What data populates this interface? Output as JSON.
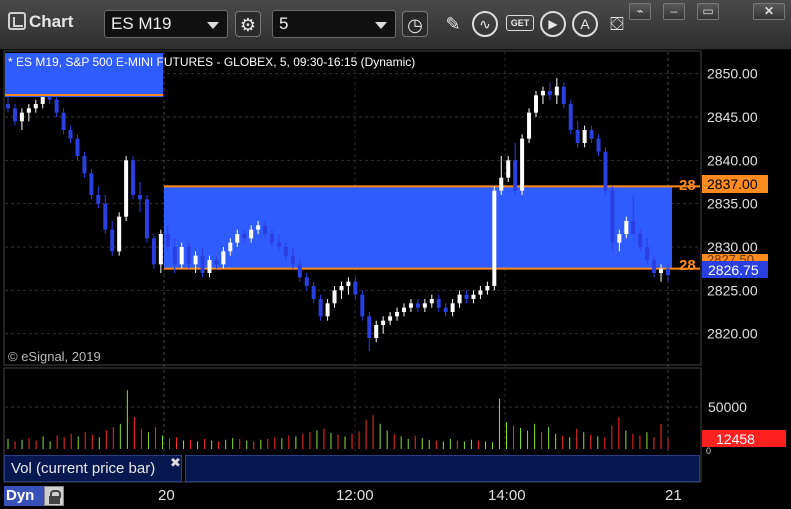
{
  "app": {
    "title": "Chart"
  },
  "toolbar": {
    "symbol": "ES M19",
    "interval": "5",
    "icons": [
      "settings-icon",
      "clock-icon",
      "pencil-icon",
      "line-chart-icon",
      "get-icon",
      "play-icon",
      "alert-icon",
      "fill-icon"
    ],
    "get_label": "GET"
  },
  "window_buttons": [
    "link-icon",
    "minimize-icon",
    "restore-icon",
    "close-icon"
  ],
  "chart": {
    "header": "* ES M19, S&P 500 E-MINI FUTURES - GLOBEX, 5, 09:30-16:15 (Dynamic)",
    "watermark": "© eSignal, 2019",
    "price_ticks": [
      "2850.00",
      "2845.00",
      "2840.00",
      "2835.00",
      "2830.00",
      "2825.00",
      "2820.00"
    ],
    "last_price": "2826.75",
    "level_upper": "2837.00",
    "level_upper_left": "28",
    "level_lower_left": "28",
    "level_lower_partial": "2827.50",
    "volume_tick": "50000",
    "volume_value": "12458",
    "volume_zero": "0",
    "time_labels": [
      "20",
      "12:00",
      "14:00",
      "21"
    ],
    "colors": {
      "up": "#ffffff",
      "down": "#2a3fe0",
      "zone": "#2f5cff",
      "level": "#ff8a1e",
      "vol_up": "#8ae234",
      "vol_down": "#ff2a2a"
    }
  },
  "chart_data": {
    "type": "candlestick",
    "symbol": "ES M19",
    "ylim": [
      2816.5,
      2852.5
    ],
    "levels": [
      2837.0,
      2827.5
    ],
    "last": 2826.75,
    "candles": [
      [
        2846.5,
        2847.5,
        2845.5,
        2846
      ],
      [
        2846,
        2846.5,
        2844,
        2844.5
      ],
      [
        2844.5,
        2846,
        2843.5,
        2845.5
      ],
      [
        2845.5,
        2846.5,
        2844.5,
        2846
      ],
      [
        2846,
        2847,
        2845.5,
        2846.5
      ],
      [
        2846.5,
        2848,
        2846,
        2847.5
      ],
      [
        2847.5,
        2848.5,
        2846.5,
        2847
      ],
      [
        2847,
        2848,
        2845,
        2845.5
      ],
      [
        2845.5,
        2846,
        2843,
        2843.5
      ],
      [
        2843.5,
        2844,
        2842,
        2842.5
      ],
      [
        2842.5,
        2843,
        2840,
        2840.5
      ],
      [
        2840.5,
        2841,
        2838,
        2838.5
      ],
      [
        2838.5,
        2839,
        2835.5,
        2836
      ],
      [
        2836,
        2837,
        2834.5,
        2835
      ],
      [
        2835,
        2836,
        2831.5,
        2832
      ],
      [
        2832,
        2833,
        2829,
        2829.5
      ],
      [
        2829.5,
        2834,
        2829,
        2833.5
      ],
      [
        2833.5,
        2840.5,
        2833,
        2840
      ],
      [
        2840,
        2840.5,
        2835.5,
        2836
      ],
      [
        2836,
        2837.5,
        2834,
        2835.5
      ],
      [
        2835.5,
        2836,
        2830.5,
        2831
      ],
      [
        2831,
        2831.5,
        2827.5,
        2828
      ],
      [
        2828,
        2832,
        2827,
        2831.5
      ],
      [
        2831.5,
        2832.5,
        2829.5,
        2830
      ],
      [
        2830,
        2831,
        2827,
        2828
      ],
      [
        2828,
        2830.5,
        2827.5,
        2830
      ],
      [
        2830,
        2830.5,
        2827.5,
        2828
      ],
      [
        2828,
        2829.5,
        2827,
        2829
      ],
      [
        2829,
        2830,
        2826.5,
        2827
      ],
      [
        2827,
        2829,
        2826.5,
        2828.5
      ],
      [
        2828.5,
        2829,
        2827.5,
        2828
      ],
      [
        2828,
        2830,
        2827.5,
        2829.5
      ],
      [
        2829.5,
        2831,
        2829,
        2830.5
      ],
      [
        2830.5,
        2832,
        2830,
        2831.5
      ],
      [
        2831.5,
        2832,
        2830.5,
        2831
      ],
      [
        2831,
        2832.5,
        2830.5,
        2832
      ],
      [
        2832,
        2833,
        2831.5,
        2832.5
      ],
      [
        2832.5,
        2833,
        2831,
        2831.5
      ],
      [
        2831.5,
        2832,
        2830,
        2830.5
      ],
      [
        2830.5,
        2831.5,
        2829.5,
        2830
      ],
      [
        2830,
        2830.5,
        2828.5,
        2829
      ],
      [
        2829,
        2830,
        2827.5,
        2828
      ],
      [
        2828,
        2828.5,
        2826,
        2826.5
      ],
      [
        2826.5,
        2827,
        2825,
        2825.5
      ],
      [
        2825.5,
        2826,
        2823.5,
        2824
      ],
      [
        2824,
        2824.5,
        2821.5,
        2822
      ],
      [
        2822,
        2824,
        2821.5,
        2823.5
      ],
      [
        2823.5,
        2825.5,
        2823,
        2825
      ],
      [
        2825,
        2826,
        2824,
        2825.5
      ],
      [
        2825.5,
        2826.5,
        2824.5,
        2826
      ],
      [
        2826,
        2826.5,
        2824,
        2824.5
      ],
      [
        2824.5,
        2825,
        2821.5,
        2822
      ],
      [
        2822,
        2822.5,
        2818,
        2819.5
      ],
      [
        2819.5,
        2821.5,
        2819,
        2821
      ],
      [
        2821,
        2822,
        2820,
        2821.5
      ],
      [
        2821.5,
        2822.5,
        2821,
        2822
      ],
      [
        2822,
        2823,
        2821.5,
        2822.5
      ],
      [
        2822.5,
        2823.5,
        2822,
        2823
      ],
      [
        2823,
        2824,
        2822.5,
        2823.5
      ],
      [
        2823.5,
        2824,
        2822.5,
        2823
      ],
      [
        2823,
        2824,
        2822.5,
        2823.5
      ],
      [
        2823.5,
        2824.5,
        2823,
        2824
      ],
      [
        2824,
        2824.5,
        2822.5,
        2823
      ],
      [
        2823,
        2823.5,
        2822,
        2822.5
      ],
      [
        2822.5,
        2824,
        2822,
        2823.5
      ],
      [
        2823.5,
        2825,
        2823,
        2824.5
      ],
      [
        2824.5,
        2825,
        2823.5,
        2824
      ],
      [
        2824,
        2825,
        2823.5,
        2824.5
      ],
      [
        2824.5,
        2825.5,
        2824,
        2825
      ],
      [
        2825,
        2826,
        2824.5,
        2825.5
      ],
      [
        2825.5,
        2837,
        2825,
        2836.5
      ],
      [
        2836.5,
        2840.5,
        2836,
        2838
      ],
      [
        2838,
        2840.5,
        2837.5,
        2840
      ],
      [
        2840,
        2842,
        2836,
        2836.5
      ],
      [
        2836.5,
        2843,
        2836,
        2842.5
      ],
      [
        2842.5,
        2846,
        2842,
        2845.5
      ],
      [
        2845.5,
        2848,
        2845,
        2847.5
      ],
      [
        2847.5,
        2848.5,
        2846.5,
        2848
      ],
      [
        2848,
        2849,
        2847,
        2847.5
      ],
      [
        2847.5,
        2849.5,
        2846.5,
        2848.5
      ],
      [
        2848.5,
        2849,
        2846,
        2846.5
      ],
      [
        2846.5,
        2847,
        2843,
        2843.5
      ],
      [
        2843.5,
        2844.5,
        2841.5,
        2842
      ],
      [
        2842,
        2844,
        2841.5,
        2843.5
      ],
      [
        2843.5,
        2844,
        2842,
        2842.5
      ],
      [
        2842.5,
        2843,
        2840.5,
        2841
      ],
      [
        2841,
        2841.5,
        2836,
        2836.5
      ],
      [
        2836.5,
        2837,
        2829.5,
        2830.5
      ],
      [
        2830.5,
        2832,
        2829.5,
        2831.5
      ],
      [
        2831.5,
        2833.5,
        2831,
        2833
      ],
      [
        2833,
        2836,
        2832,
        2831.5
      ],
      [
        2831.5,
        2832,
        2829.5,
        2830
      ],
      [
        2830,
        2831,
        2828,
        2828.5
      ],
      [
        2828.5,
        2829,
        2826.5,
        2827
      ],
      [
        2827,
        2828,
        2826,
        2827.5
      ],
      [
        2827.5,
        2828,
        2826,
        2826.75
      ]
    ],
    "volume": [
      [
        12000,
        1
      ],
      [
        9000,
        0
      ],
      [
        11000,
        1
      ],
      [
        13000,
        0
      ],
      [
        10000,
        0
      ],
      [
        15000,
        1
      ],
      [
        9000,
        1
      ],
      [
        16000,
        0
      ],
      [
        14000,
        0
      ],
      [
        18000,
        0
      ],
      [
        15000,
        1
      ],
      [
        20000,
        0
      ],
      [
        17000,
        0
      ],
      [
        14000,
        1
      ],
      [
        22000,
        0
      ],
      [
        26000,
        0
      ],
      [
        30000,
        1
      ],
      [
        70000,
        1
      ],
      [
        38000,
        0
      ],
      [
        24000,
        0
      ],
      [
        20000,
        1
      ],
      [
        26000,
        0
      ],
      [
        16000,
        1
      ],
      [
        12000,
        0
      ],
      [
        14000,
        0
      ],
      [
        10000,
        1
      ],
      [
        11000,
        0
      ],
      [
        9000,
        1
      ],
      [
        12000,
        0
      ],
      [
        10000,
        1
      ],
      [
        9000,
        0
      ],
      [
        11000,
        1
      ],
      [
        13000,
        1
      ],
      [
        12000,
        0
      ],
      [
        10000,
        1
      ],
      [
        9000,
        0
      ],
      [
        11000,
        1
      ],
      [
        12000,
        0
      ],
      [
        14000,
        0
      ],
      [
        13000,
        1
      ],
      [
        16000,
        0
      ],
      [
        15000,
        1
      ],
      [
        18000,
        0
      ],
      [
        20000,
        0
      ],
      [
        22000,
        1
      ],
      [
        24000,
        0
      ],
      [
        19000,
        1
      ],
      [
        17000,
        0
      ],
      [
        15000,
        1
      ],
      [
        18000,
        0
      ],
      [
        21000,
        0
      ],
      [
        35000,
        0
      ],
      [
        40000,
        0
      ],
      [
        30000,
        1
      ],
      [
        22000,
        1
      ],
      [
        18000,
        0
      ],
      [
        15000,
        1
      ],
      [
        12000,
        1
      ],
      [
        16000,
        0
      ],
      [
        13000,
        1
      ],
      [
        11000,
        1
      ],
      [
        10000,
        0
      ],
      [
        9000,
        1
      ],
      [
        12000,
        1
      ],
      [
        10000,
        0
      ],
      [
        9000,
        1
      ],
      [
        11000,
        1
      ],
      [
        10000,
        0
      ],
      [
        9000,
        1
      ],
      [
        8000,
        1
      ],
      [
        60000,
        1
      ],
      [
        32000,
        1
      ],
      [
        28000,
        0
      ],
      [
        25000,
        1
      ],
      [
        22000,
        1
      ],
      [
        30000,
        1
      ],
      [
        20000,
        0
      ],
      [
        26000,
        1
      ],
      [
        18000,
        1
      ],
      [
        16000,
        0
      ],
      [
        14000,
        1
      ],
      [
        24000,
        0
      ],
      [
        20000,
        1
      ],
      [
        17000,
        0
      ],
      [
        15000,
        1
      ],
      [
        14000,
        0
      ],
      [
        28000,
        0
      ],
      [
        38000,
        0
      ],
      [
        22000,
        1
      ],
      [
        18000,
        0
      ],
      [
        16000,
        0
      ],
      [
        20000,
        1
      ],
      [
        14000,
        0
      ],
      [
        30000,
        0
      ],
      [
        12458,
        0
      ]
    ]
  }
}
